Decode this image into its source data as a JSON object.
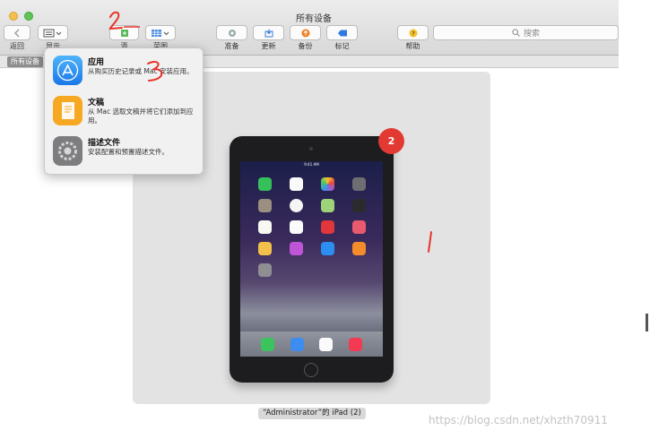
{
  "window": {
    "title": "所有设备"
  },
  "toolbar": {
    "back_label": "返回",
    "display_label": "显示",
    "add_label": "添",
    "arrange_label": "菜图",
    "prepare_label": "准备",
    "update_label": "更新",
    "backup_label": "备份",
    "tag_label": "标记",
    "help_label": "帮助"
  },
  "search": {
    "placeholder": "搜索"
  },
  "breadcrumb": {
    "label": "所有设备"
  },
  "menu": {
    "items": [
      {
        "title": "应用",
        "desc": "从购买历史记录或 Mac 安装应用。",
        "icon": "app-store-icon",
        "color": "#1e8bf0"
      },
      {
        "title": "文稿",
        "desc": "从 Mac 选取文稿并将它们添加到应用。",
        "icon": "document-icon",
        "color": "#f6a823"
      },
      {
        "title": "描述文件",
        "desc": "安装配置和预置描述文件。",
        "icon": "settings-gear-icon",
        "color": "#7d7d80"
      }
    ]
  },
  "device": {
    "name": "“Administrator”的 iPad (2)",
    "badge": "2",
    "status_time": "9:41 AM"
  },
  "annotations": {
    "first": "1",
    "second": "2",
    "third": "3"
  },
  "watermark": "https://blog.csdn.net/xhzth70911",
  "colors": {
    "badge": "#e23a33",
    "annotation": "#e8332b",
    "accent": "#1e8bf0"
  }
}
